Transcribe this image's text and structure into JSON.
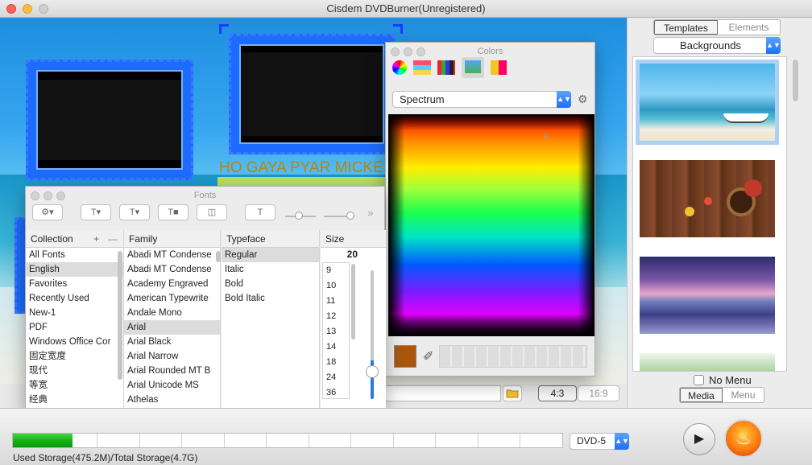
{
  "window": {
    "title": "Cisdem DVDBurner(Unregistered)"
  },
  "canvas": {
    "menu_title": "HO GAYA PYAR MICKE"
  },
  "right_panel": {
    "tabs": [
      {
        "label": "Templates",
        "active": true
      },
      {
        "label": "Elements",
        "active": false
      }
    ],
    "category": "Backgrounds",
    "no_menu_label": "No Menu",
    "view_tabs": [
      {
        "label": "Media",
        "active": true
      },
      {
        "label": "Menu",
        "active": false
      }
    ]
  },
  "aspect": {
    "ratio_4_3": "4:3",
    "ratio_16_9": "16:9"
  },
  "colors_panel": {
    "title": "Colors",
    "mode": "Spectrum",
    "current_color": "#a8580e",
    "tabs": [
      "color-wheel-icon",
      "sliders-icon",
      "palettes-icon",
      "image-palettes-icon",
      "crayons-icon"
    ]
  },
  "fonts_panel": {
    "title": "Fonts",
    "headers": {
      "collection": "Collection",
      "family": "Family",
      "typeface": "Typeface",
      "size": "Size"
    },
    "size_value": "20",
    "collections": [
      "All Fonts",
      "English",
      "Favorites",
      "Recently Used",
      "New-1",
      "PDF",
      "Windows Office Cor",
      "固定宽度",
      "现代",
      "等宽",
      "经典"
    ],
    "selected_collection": "English",
    "families": [
      "Abadi MT Condense",
      "Abadi MT Condense",
      "Academy Engraved",
      "American Typewrite",
      "Andale Mono",
      "Arial",
      "Arial Black",
      "Arial Narrow",
      "Arial Rounded MT B",
      "Arial Unicode MS",
      "Athelas"
    ],
    "selected_family": "Arial",
    "typefaces": [
      "Regular",
      "Italic",
      "Bold",
      "Bold Italic"
    ],
    "selected_typeface": "Regular",
    "sizes": [
      "9",
      "10",
      "11",
      "12",
      "13",
      "14",
      "18",
      "24",
      "36"
    ]
  },
  "bottom": {
    "storage_text": "Used Storage(475.2M)/Total Storage(4.7G)",
    "storage_used_fraction": 0.108,
    "disc_type": "DVD-5"
  }
}
